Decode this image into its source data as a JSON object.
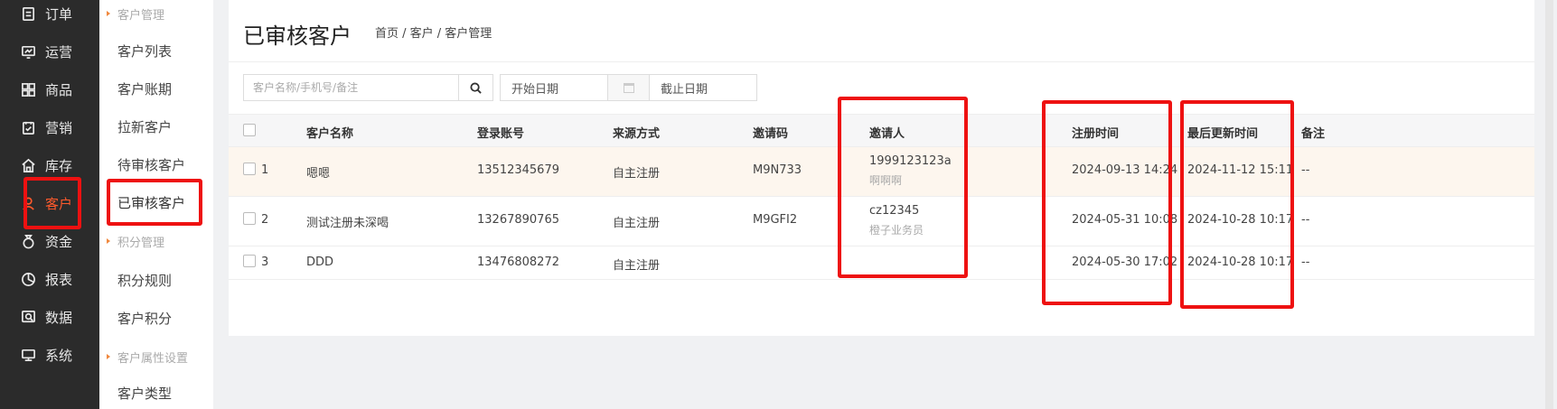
{
  "nav": {
    "items": [
      {
        "label": "订单",
        "icon": "order-icon"
      },
      {
        "label": "运营",
        "icon": "operation-icon"
      },
      {
        "label": "商品",
        "icon": "goods-icon"
      },
      {
        "label": "营销",
        "icon": "marketing-icon"
      },
      {
        "label": "库存",
        "icon": "warehouse-icon"
      },
      {
        "label": "客户",
        "icon": "customer-icon",
        "active": true
      },
      {
        "label": "资金",
        "icon": "money-icon"
      },
      {
        "label": "报表",
        "icon": "report-icon"
      },
      {
        "label": "数据",
        "icon": "data-icon"
      },
      {
        "label": "系统",
        "icon": "system-icon"
      }
    ],
    "active_color": "#ff5a2c"
  },
  "submenu": {
    "groups": [
      "客户管理",
      "积分管理",
      "客户属性设置"
    ],
    "items": [
      "客户列表",
      "客户账期",
      "拉新客户",
      "待审核客户",
      "已审核客户",
      "积分规则",
      "客户积分",
      "客户类型"
    ]
  },
  "header": {
    "title": "已审核客户",
    "breadcrumb": "首页 / 客户 / 客户管理"
  },
  "filters": {
    "search_placeholder": "客户名称/手机号/备注",
    "start_date": "开始日期",
    "end_date": "截止日期"
  },
  "table": {
    "columns": [
      "客户名称",
      "登录账号",
      "来源方式",
      "邀请码",
      "邀请人",
      "注册时间",
      "最后更新时间",
      "备注"
    ],
    "rows": [
      {
        "no": "1",
        "name": "嗯嗯",
        "account": "13512345679",
        "source": "自主注册",
        "code": "M9N733",
        "inviter": "1999123123a",
        "inviter_sub": "啊啊啊",
        "registered": "2024-09-13 14:24",
        "updated": "2024-11-12 15:11",
        "remark": "--"
      },
      {
        "no": "2",
        "name": "测试注册未深喝",
        "account": "13267890765",
        "source": "自主注册",
        "code": "M9GFI2",
        "inviter": "cz12345",
        "inviter_sub": "橙子业务员",
        "registered": "2024-05-31 10:08",
        "updated": "2024-10-28 10:17",
        "remark": "--"
      },
      {
        "no": "3",
        "name": "DDD",
        "account": "13476808272",
        "source": "自主注册",
        "code": "",
        "inviter": "",
        "inviter_sub": "",
        "registered": "2024-05-30 17:02",
        "updated": "2024-10-28 10:17",
        "remark": "--"
      }
    ]
  },
  "highlight_color": "#ee1111"
}
